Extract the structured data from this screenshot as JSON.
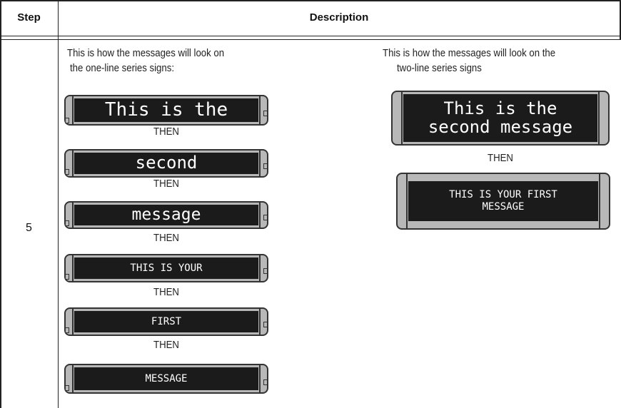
{
  "table": {
    "headers": {
      "step": "Step",
      "description": "Description"
    },
    "step_number": "5"
  },
  "left": {
    "intro_line1": "This is how the messages will look on",
    "intro_line2": "the one-line series signs:",
    "signs": [
      "This is the",
      "second",
      "message",
      "THIS IS YOUR",
      "FIRST",
      "MESSAGE"
    ],
    "then_label": "THEN"
  },
  "right": {
    "intro_line1": "This is how the messages will look on the",
    "intro_line2": "two-line series signs",
    "sign1": {
      "line1": "This is the",
      "line2": "second message"
    },
    "then_label": "THEN",
    "sign2": {
      "line1": "THIS IS YOUR FIRST",
      "line2": "MESSAGE"
    }
  }
}
